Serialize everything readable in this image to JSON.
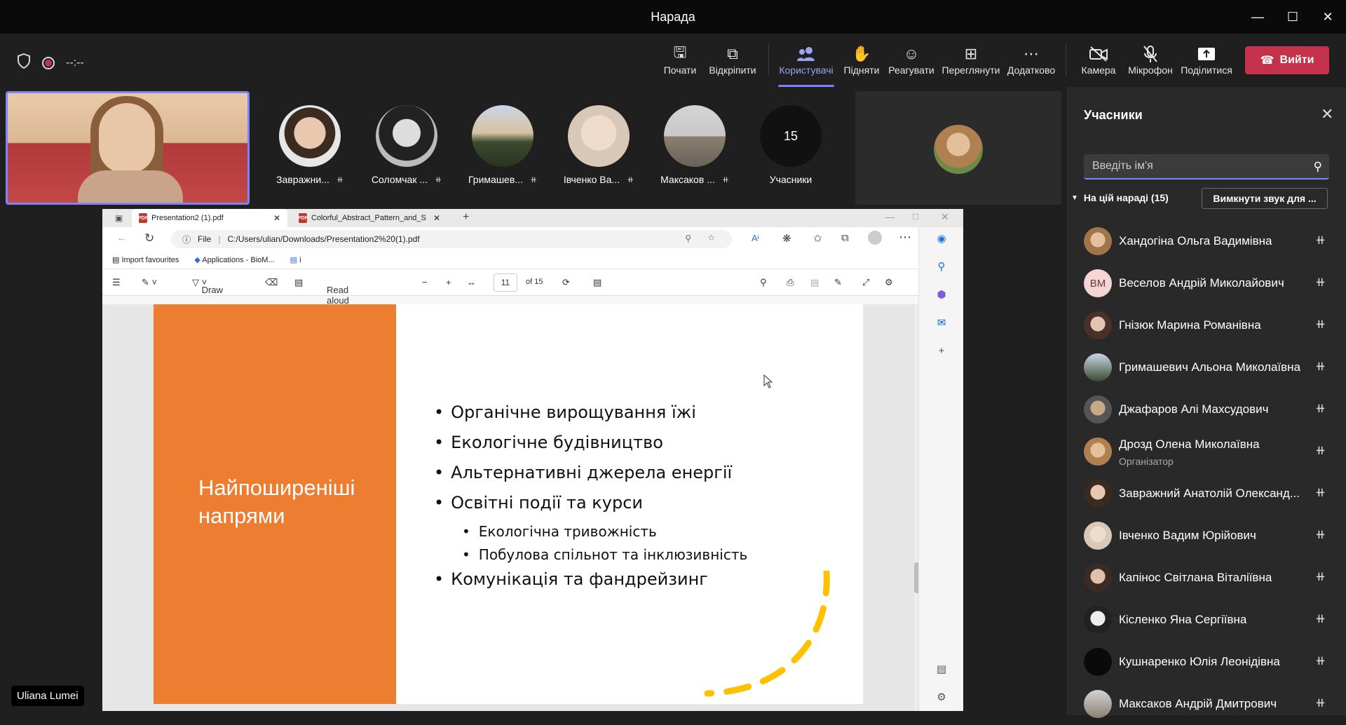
{
  "window": {
    "title": "Нарада"
  },
  "toolbar": {
    "timer": "--:--",
    "buttons": [
      {
        "label": "Почати",
        "icon": "screen-start-icon"
      },
      {
        "label": "Відкріпити",
        "icon": "pop-out-icon"
      },
      {
        "label": "Користувачі",
        "icon": "people-icon"
      },
      {
        "label": "Підняти",
        "icon": "raise-hand-icon"
      },
      {
        "label": "Реагувати",
        "icon": "emoji-icon"
      },
      {
        "label": "Переглянути",
        "icon": "grid-view-icon"
      },
      {
        "label": "Додатково",
        "icon": "more-icon"
      },
      {
        "label": "Камера",
        "icon": "camera-off-icon"
      },
      {
        "label": "Мікрофон",
        "icon": "mic-off-icon"
      },
      {
        "label": "Поділитися",
        "icon": "share-icon"
      }
    ],
    "leave_label": "Вийти"
  },
  "gallery": {
    "tiles": [
      {
        "name": "Завражни..."
      },
      {
        "name": "Соломчак ..."
      },
      {
        "name": "Гримашев..."
      },
      {
        "name": "Івченко Ва..."
      },
      {
        "name": "Максаков ..."
      }
    ],
    "count_value": "15",
    "count_label": "Учасники",
    "self_name": "Uliana Lumei"
  },
  "browser": {
    "tab1": "Presentation2 (1).pdf",
    "tab2": "Colorful_Abstract_Pattern_and_S",
    "file_label": "File",
    "url": "C:/Users/ulian/Downloads/Presentation2%20(1).pdf",
    "fav1": "Import favourites",
    "fav2": "Applications - BioM...",
    "fav3": "i",
    "draw_label": "Draw",
    "read_aloud": "Read aloud",
    "page_num": "11",
    "page_total": "of 15"
  },
  "slide": {
    "heading_line1": "Найпоширеніші",
    "heading_line2": "напрями",
    "b1": "Органічне вирощування їжі",
    "b2": "Екологічне будівництво",
    "b3": "Альтернативні джерела енергії",
    "b4": "Освітні події та курси",
    "b4a": "Екологічна тривожність",
    "b4b": "Побулова спільнот та інклюзивність",
    "b5": "Комунікація та фандрейзинг"
  },
  "panel": {
    "title": "Учасники",
    "search_placeholder": "Введіть ім'я",
    "section_label": "На цій нараді (15)",
    "mute_all": "Вимкнути звук для ...",
    "participants": [
      {
        "name": "Хандогіна Ольга Вадимівна",
        "role": ""
      },
      {
        "name": "Веселов Андрій Миколайович",
        "role": "",
        "initials": "ВМ"
      },
      {
        "name": "Гнізюк Марина Романівна",
        "role": ""
      },
      {
        "name": "Гримашевич Альона Миколаївна",
        "role": ""
      },
      {
        "name": "Джафаров Алі Махсудович",
        "role": ""
      },
      {
        "name": "Дрозд Олена Миколаївна",
        "role": "Організатор"
      },
      {
        "name": "Завражний Анатолій Олександ...",
        "role": ""
      },
      {
        "name": "Івченко Вадим Юрійович",
        "role": ""
      },
      {
        "name": "Капінос Світлана Віталіївна",
        "role": ""
      },
      {
        "name": "Кісленко Яна Сергіївна",
        "role": ""
      },
      {
        "name": "Кушнаренко Юлія Леонідівна",
        "role": ""
      },
      {
        "name": "Максаков Андрій Дмитрович",
        "role": ""
      }
    ]
  },
  "colors": {
    "accent": "#7f85f5",
    "leave": "#c4314b",
    "slide_orange": "#ed7d31",
    "slide_yellow": "#ffc000"
  }
}
